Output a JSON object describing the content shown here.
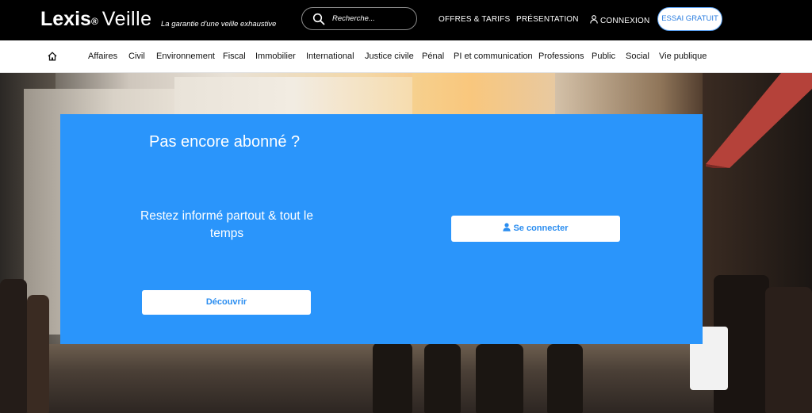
{
  "header": {
    "brand_part1": "Lexis",
    "brand_reg": "®",
    "brand_part2": "Veille",
    "tagline": "La garantie d'une veille exhaustive",
    "search_placeholder": "Recherche...",
    "nav": {
      "offres": "OFFRES & TARIFS",
      "presentation": "PRÉSENTATION",
      "connexion": "CONNEXION",
      "essai": "ESSAI GRATUIT"
    }
  },
  "categories": [
    "Affaires",
    "Civil",
    "Environnement",
    "Fiscal",
    "Immobilier",
    "International",
    "Justice civile",
    "Pénal",
    "PI et communication",
    "Professions",
    "Public",
    "Social",
    "Vie publique"
  ],
  "hero": {
    "title": "Pas encore abonné ?",
    "subtitle": "Restez informé partout & tout le temps",
    "discover_button": "Découvrir",
    "connect_button": "Se connecter"
  },
  "colors": {
    "panel": "#2a95fb",
    "button_text": "#2a8df0",
    "header_bg": "#000000"
  },
  "icons": {
    "home": "home-icon",
    "search": "search-icon",
    "user": "user-icon"
  }
}
